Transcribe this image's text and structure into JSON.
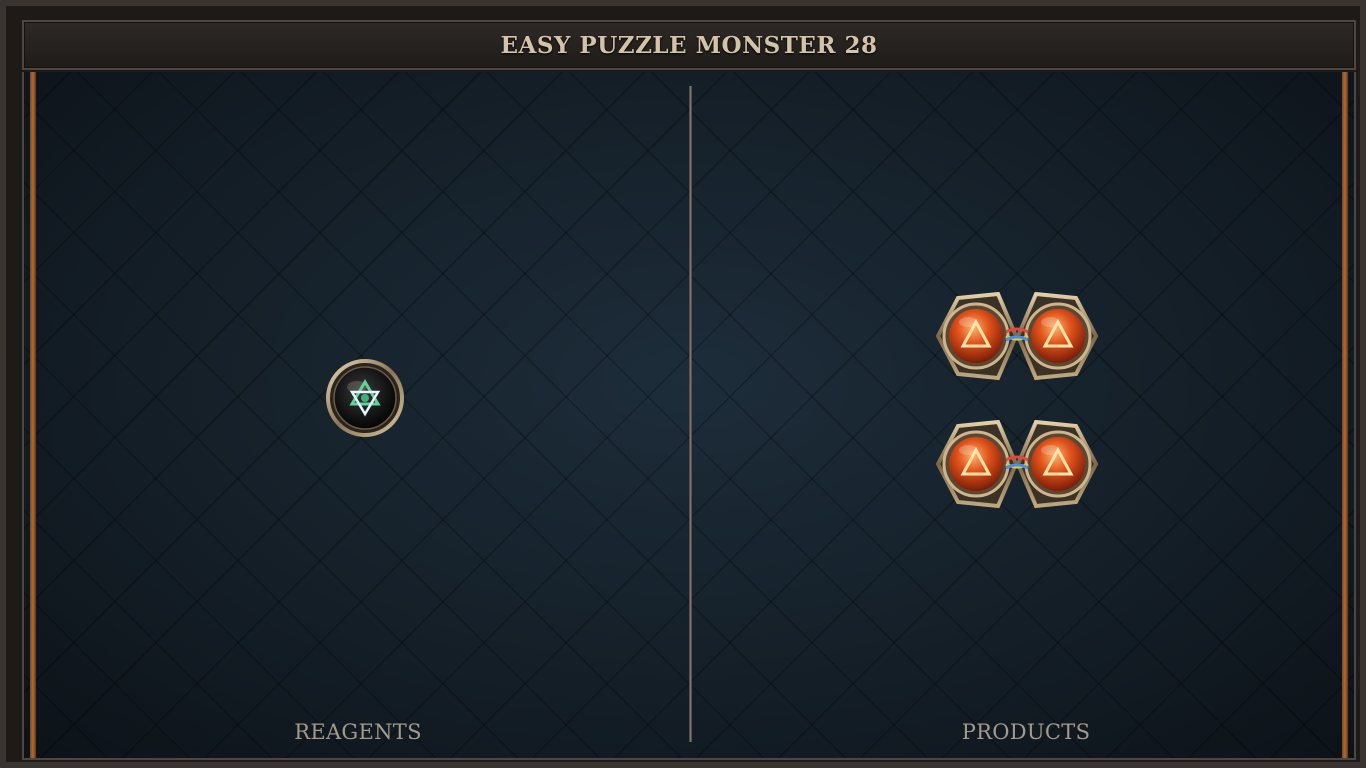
{
  "title": "EASY PUZZLE MONSTER 28",
  "panels": {
    "reagents_label": "REAGENTS",
    "products_label": "PRODUCTS"
  },
  "reagents": [
    {
      "element": "hexagram-icon",
      "color": "#4cc28a"
    }
  ],
  "products": [
    {
      "atoms": [
        "fire-triangle-icon",
        "fire-triangle-icon"
      ],
      "bond": "triple"
    },
    {
      "atoms": [
        "fire-triangle-icon",
        "fire-triangle-icon"
      ],
      "bond": "triple"
    }
  ],
  "colors": {
    "title_text": "#d4c3a8",
    "label_text": "#a39a8e",
    "fire_atom": "#e0521a",
    "rail": "#b06a34"
  }
}
